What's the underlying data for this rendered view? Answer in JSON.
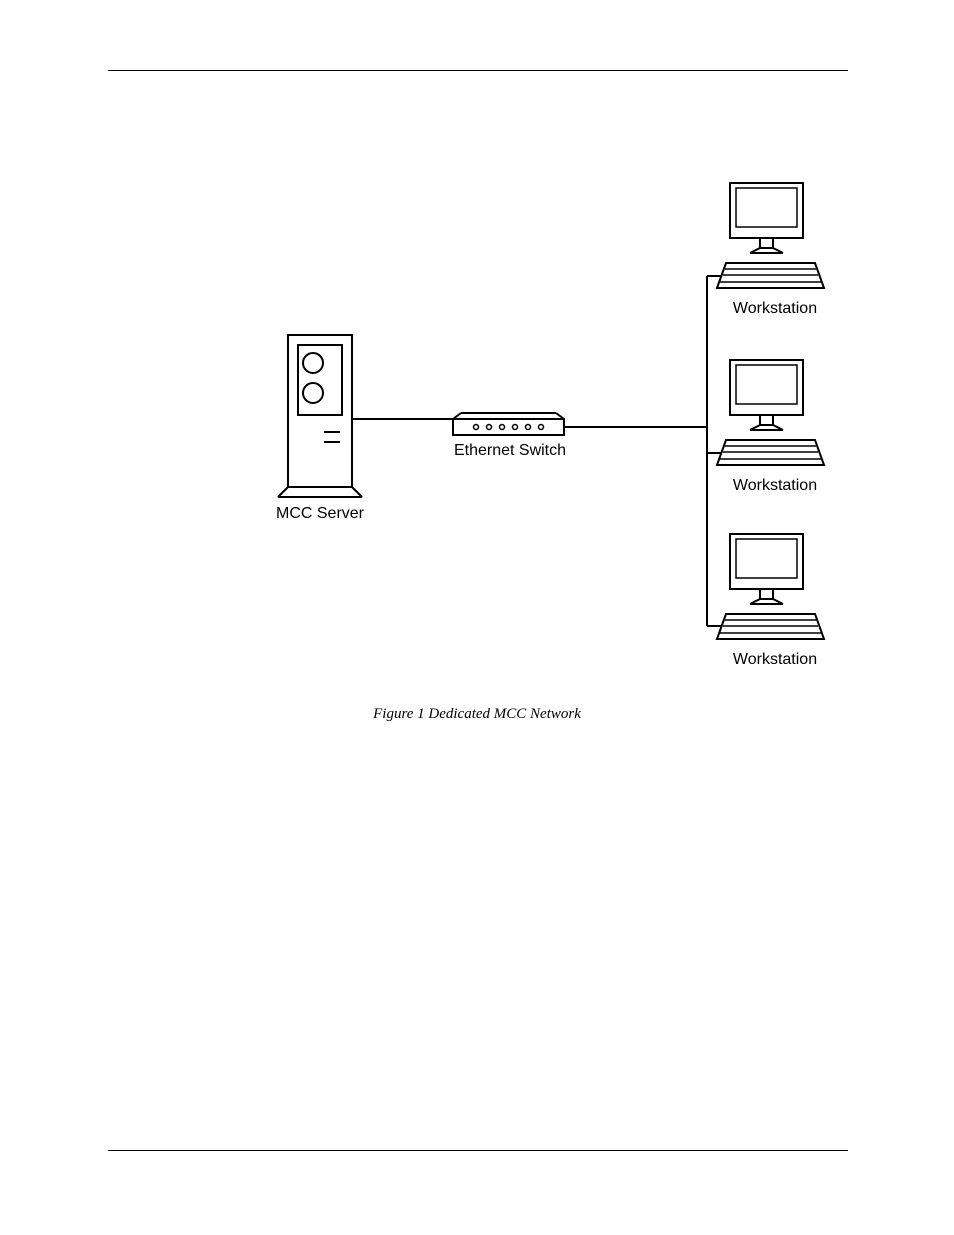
{
  "diagram": {
    "server_label": "MCC Server",
    "switch_label": "Ethernet Switch",
    "workstation1_label": "Workstation",
    "workstation2_label": "Workstation",
    "workstation3_label": "Workstation",
    "caption": "Figure 1 Dedicated MCC Network"
  }
}
